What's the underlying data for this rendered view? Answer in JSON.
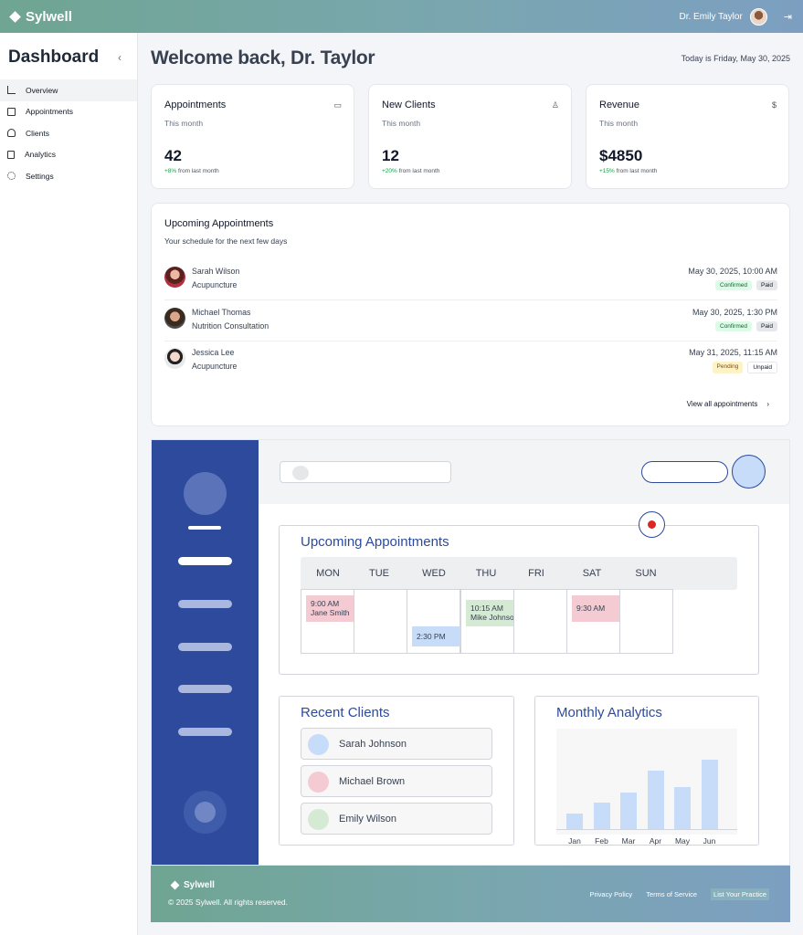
{
  "topbar": {
    "brand": "Sylwell",
    "user_name": "Dr. Emily Taylor",
    "logout_icon": "logout-icon"
  },
  "sidebar": {
    "title": "Dashboard",
    "collapse_icon": "chevron-left-icon",
    "items": [
      {
        "label": "Overview",
        "icon": "bar-chart-icon",
        "active": true
      },
      {
        "label": "Appointments",
        "icon": "calendar-icon"
      },
      {
        "label": "Clients",
        "icon": "users-icon"
      },
      {
        "label": "Analytics",
        "icon": "document-icon"
      },
      {
        "label": "Settings",
        "icon": "gear-icon"
      }
    ]
  },
  "header": {
    "welcome": "Welcome back, Dr. Taylor",
    "today": "Today is Friday, May 30, 2025"
  },
  "stats": [
    {
      "title": "Appointments",
      "subtitle": "This month",
      "value": "42",
      "change_pct": "+8%",
      "change_text": " from last month",
      "icon": "calendar-icon",
      "icon_glyph": "▭"
    },
    {
      "title": "New Clients",
      "subtitle": "This month",
      "value": "12",
      "change_pct": "+20%",
      "change_text": " from last month",
      "icon": "user-icon",
      "icon_glyph": "♙"
    },
    {
      "title": "Revenue",
      "subtitle": "This month",
      "value": "$4850",
      "change_pct": "+15%",
      "change_text": " from last month",
      "icon": "dollar-icon",
      "icon_glyph": "$"
    }
  ],
  "upcoming": {
    "title": "Upcoming Appointments",
    "subtitle": "Your schedule for the next few days",
    "view_all": "View all appointments",
    "appointments": [
      {
        "name": "Sarah Wilson",
        "service": "Acupuncture",
        "datetime": "May 30, 2025, 10:00 AM",
        "status": "Confirmed",
        "payment": "Paid"
      },
      {
        "name": "Michael Thomas",
        "service": "Nutrition Consultation",
        "datetime": "May 30, 2025, 1:30 PM",
        "status": "Confirmed",
        "payment": "Paid"
      },
      {
        "name": "Jessica Lee",
        "service": "Acupuncture",
        "datetime": "May 31, 2025, 11:15 AM",
        "status": "Pending",
        "payment": "Unpaid"
      }
    ]
  },
  "mockup": {
    "calendar": {
      "title": "Upcoming Appointments",
      "days": [
        "MON",
        "TUE",
        "WED",
        "THU",
        "FRI",
        "SAT",
        "SUN"
      ],
      "events": [
        {
          "day": "MON",
          "time": "9:00 AM",
          "name": "Jane Smith",
          "color": "#f4cbd3"
        },
        {
          "day": "WED",
          "time": "2:30 PM",
          "name": "",
          "color": "#c7dcf8"
        },
        {
          "day": "THU",
          "time": "10:15 AM",
          "name": "Mike Johnson",
          "color": "#d4ead3"
        },
        {
          "day": "SAT",
          "time": "9:30 AM",
          "name": "",
          "color": "#f4cbd3"
        }
      ]
    },
    "recent_clients": {
      "title": "Recent Clients",
      "clients": [
        {
          "name": "Sarah Johnson",
          "color": "#c7dcf8"
        },
        {
          "name": "Michael Brown",
          "color": "#f4cbd3"
        },
        {
          "name": "Emily Wilson",
          "color": "#d4ead3"
        }
      ]
    },
    "analytics": {
      "title": "Monthly Analytics"
    }
  },
  "chart_data": {
    "type": "bar",
    "title": "Monthly Analytics",
    "categories": [
      "Jan",
      "Feb",
      "Mar",
      "Apr",
      "May",
      "Jun"
    ],
    "values": [
      17,
      29,
      40,
      64,
      46,
      76
    ],
    "ylim": [
      0,
      100
    ],
    "grid": false
  },
  "footer": {
    "brand": "Sylwell",
    "copyright": "© 2025 Sylwell. All rights reserved.",
    "links": [
      "Privacy Policy",
      "Terms of Service"
    ],
    "cta": "List Your Practice"
  },
  "colors": {
    "accent": "#2d4a9c",
    "positive": "#16a34a",
    "topbar_start": "#6fa592",
    "topbar_end": "#7c9fc1"
  }
}
